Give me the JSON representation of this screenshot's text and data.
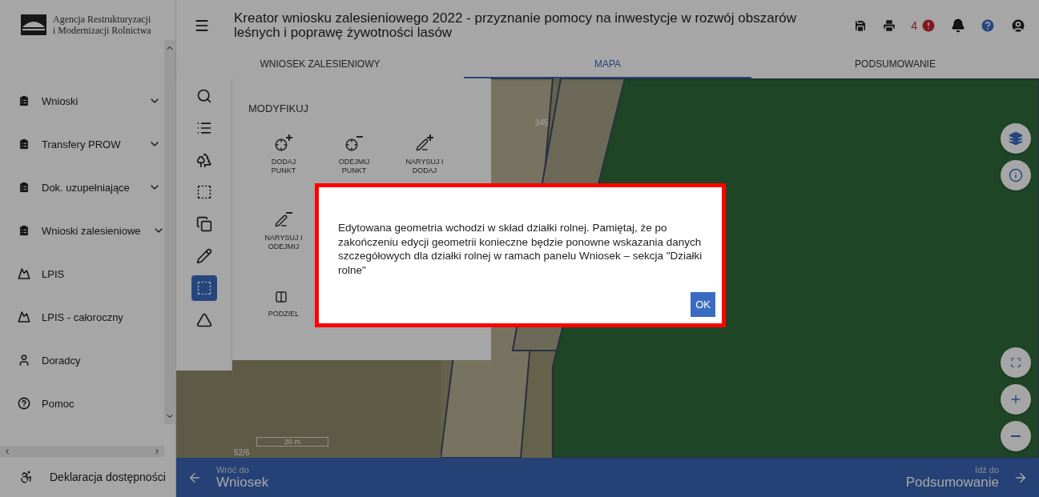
{
  "logo": {
    "line1": "Agencja Restrukturyzacji",
    "line2": "i Modernizacji Rolnictwa"
  },
  "sidebar": {
    "items": [
      {
        "label": "Wnioski",
        "expandable": true
      },
      {
        "label": "Transfery PROW",
        "expandable": true
      },
      {
        "label": "Dok. uzupełniające",
        "expandable": true
      },
      {
        "label": "Wnioski zalesieniowe",
        "expandable": true
      },
      {
        "label": "LPIS",
        "expandable": false
      },
      {
        "label": "LPIS - całoroczny",
        "expandable": false
      },
      {
        "label": "Doradcy",
        "expandable": false
      },
      {
        "label": "Pomoc",
        "expandable": false
      }
    ],
    "footer": "Deklaracja dostępności"
  },
  "header": {
    "title": "Kreator wniosku zalesieniowego 2022 - przyznanie pomocy na inwestycje w rozwój obszarów leśnych i poprawę żywotności lasów",
    "error_count": "4"
  },
  "tabs": [
    {
      "label": "WNIOSEK ZALESIENIOWY",
      "selected": false
    },
    {
      "label": "MAPA",
      "selected": true
    },
    {
      "label": "PODSUMOWANIE",
      "selected": false
    }
  ],
  "toolrail": [
    {
      "selected": false
    },
    {
      "selected": false
    },
    {
      "selected": false
    },
    {
      "selected": false
    },
    {
      "selected": false
    },
    {
      "selected": false
    },
    {
      "selected": true
    },
    {
      "selected": false
    }
  ],
  "panel": {
    "title": "MODYFIKUJ",
    "tool_rows": [
      [
        "DODAJ PUNKT",
        "ODEJMIJ PUNKT",
        "NARYSUJ I DODAJ"
      ],
      [
        "NARYSUJ I ODEJMIJ"
      ],
      [
        "PODZIEL"
      ]
    ]
  },
  "map": {
    "parcel_labels": [
      "345",
      "52/6"
    ],
    "scale": "20 m"
  },
  "dialog": {
    "message": "Edytowana geometria wchodzi w skład działki rolnej. Pamiętaj, że po zakończeniu edycji geometrii konieczne będzie ponowne wskazania danych szczegółowych dla działki rolnej w ramach panelu Wniosek – sekcja \"Działki rolne\"",
    "button": "OK"
  },
  "footer_nav": {
    "back_caption": "Wróć do",
    "back_label": "Wniosek",
    "next_caption": "Idź do",
    "next_label": "Podsumowanie"
  }
}
